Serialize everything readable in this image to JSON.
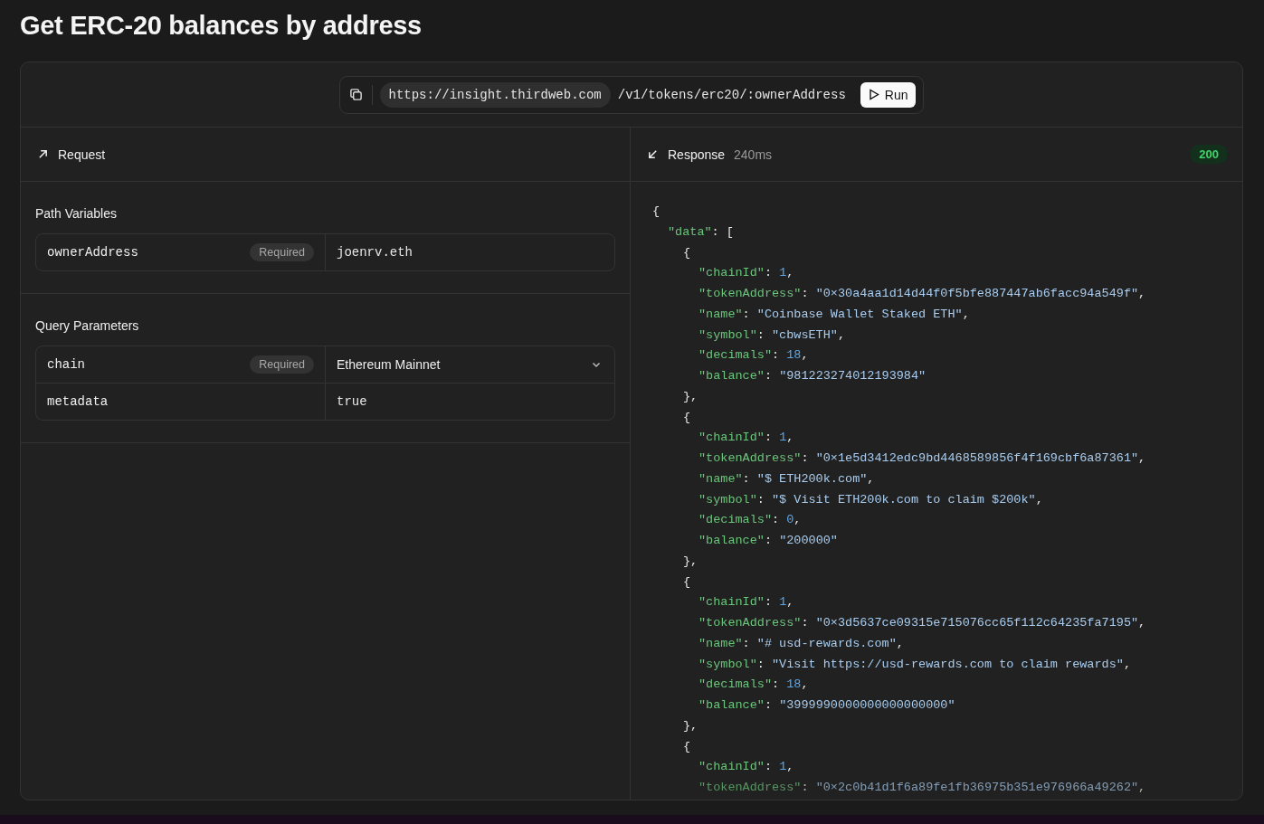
{
  "title": "Get ERC-20 balances by address",
  "url_bar": {
    "base_url": "https://insight.thirdweb.com",
    "path": "/v1/tokens/erc20/:ownerAddress",
    "run_label": "Run"
  },
  "request": {
    "label": "Request",
    "sections": [
      {
        "title": "Path Variables",
        "params": [
          {
            "name": "ownerAddress",
            "required": true,
            "required_label": "Required",
            "kind": "text",
            "value": "joenrv.eth"
          }
        ]
      },
      {
        "title": "Query Parameters",
        "params": [
          {
            "name": "chain",
            "required": true,
            "required_label": "Required",
            "kind": "select",
            "value": "Ethereum Mainnet"
          },
          {
            "name": "metadata",
            "required": false,
            "kind": "text",
            "value": "true"
          }
        ]
      }
    ]
  },
  "response": {
    "label": "Response",
    "time": "240ms",
    "status": "200",
    "lines": [
      {
        "tokens": [
          {
            "kind": "punct",
            "text": "{"
          }
        ],
        "children": [
          {
            "tokens": [
              {
                "kind": "key",
                "text": "\"data\""
              },
              {
                "kind": "punct",
                "text": ": ["
              }
            ],
            "children": [
              {
                "tokens": [
                  {
                    "kind": "punct",
                    "text": "{"
                  }
                ],
                "children": [
                  {
                    "tokens": [
                      {
                        "kind": "key",
                        "text": "\"chainId\""
                      },
                      {
                        "kind": "punct",
                        "text": ": "
                      },
                      {
                        "kind": "number",
                        "text": "1"
                      },
                      {
                        "kind": "punct",
                        "text": ","
                      }
                    ]
                  },
                  {
                    "tokens": [
                      {
                        "kind": "key",
                        "text": "\"tokenAddress\""
                      },
                      {
                        "kind": "punct",
                        "text": ": "
                      },
                      {
                        "kind": "string",
                        "text": "\"0×30a4aa1d14d44f0f5bfe887447ab6facc94a549f\""
                      },
                      {
                        "kind": "punct",
                        "text": ","
                      }
                    ]
                  },
                  {
                    "tokens": [
                      {
                        "kind": "key",
                        "text": "\"name\""
                      },
                      {
                        "kind": "punct",
                        "text": ": "
                      },
                      {
                        "kind": "string",
                        "text": "\"Coinbase Wallet Staked ETH\""
                      },
                      {
                        "kind": "punct",
                        "text": ","
                      }
                    ]
                  },
                  {
                    "tokens": [
                      {
                        "kind": "key",
                        "text": "\"symbol\""
                      },
                      {
                        "kind": "punct",
                        "text": ": "
                      },
                      {
                        "kind": "string",
                        "text": "\"cbwsETH\""
                      },
                      {
                        "kind": "punct",
                        "text": ","
                      }
                    ]
                  },
                  {
                    "tokens": [
                      {
                        "kind": "key",
                        "text": "\"decimals\""
                      },
                      {
                        "kind": "punct",
                        "text": ": "
                      },
                      {
                        "kind": "number",
                        "text": "18"
                      },
                      {
                        "kind": "punct",
                        "text": ","
                      }
                    ]
                  },
                  {
                    "tokens": [
                      {
                        "kind": "key",
                        "text": "\"balance\""
                      },
                      {
                        "kind": "punct",
                        "text": ": "
                      },
                      {
                        "kind": "string",
                        "text": "\"981223274012193984\""
                      }
                    ]
                  }
                ]
              },
              {
                "tokens": [
                  {
                    "kind": "punct",
                    "text": "},"
                  }
                ]
              },
              {
                "tokens": [
                  {
                    "kind": "punct",
                    "text": "{"
                  }
                ],
                "children": [
                  {
                    "tokens": [
                      {
                        "kind": "key",
                        "text": "\"chainId\""
                      },
                      {
                        "kind": "punct",
                        "text": ": "
                      },
                      {
                        "kind": "number",
                        "text": "1"
                      },
                      {
                        "kind": "punct",
                        "text": ","
                      }
                    ]
                  },
                  {
                    "tokens": [
                      {
                        "kind": "key",
                        "text": "\"tokenAddress\""
                      },
                      {
                        "kind": "punct",
                        "text": ": "
                      },
                      {
                        "kind": "string",
                        "text": "\"0×1e5d3412edc9bd4468589856f4f169cbf6a87361\""
                      },
                      {
                        "kind": "punct",
                        "text": ","
                      }
                    ]
                  },
                  {
                    "tokens": [
                      {
                        "kind": "key",
                        "text": "\"name\""
                      },
                      {
                        "kind": "punct",
                        "text": ": "
                      },
                      {
                        "kind": "string",
                        "text": "\"$ ETH200k.com\""
                      },
                      {
                        "kind": "punct",
                        "text": ","
                      }
                    ]
                  },
                  {
                    "tokens": [
                      {
                        "kind": "key",
                        "text": "\"symbol\""
                      },
                      {
                        "kind": "punct",
                        "text": ": "
                      },
                      {
                        "kind": "string",
                        "text": "\"$ Visit ETH200k.com to claim $200k\""
                      },
                      {
                        "kind": "punct",
                        "text": ","
                      }
                    ]
                  },
                  {
                    "tokens": [
                      {
                        "kind": "key",
                        "text": "\"decimals\""
                      },
                      {
                        "kind": "punct",
                        "text": ": "
                      },
                      {
                        "kind": "number",
                        "text": "0"
                      },
                      {
                        "kind": "punct",
                        "text": ","
                      }
                    ]
                  },
                  {
                    "tokens": [
                      {
                        "kind": "key",
                        "text": "\"balance\""
                      },
                      {
                        "kind": "punct",
                        "text": ": "
                      },
                      {
                        "kind": "string",
                        "text": "\"200000\""
                      }
                    ]
                  }
                ]
              },
              {
                "tokens": [
                  {
                    "kind": "punct",
                    "text": "},"
                  }
                ]
              },
              {
                "tokens": [
                  {
                    "kind": "punct",
                    "text": "{"
                  }
                ],
                "children": [
                  {
                    "tokens": [
                      {
                        "kind": "key",
                        "text": "\"chainId\""
                      },
                      {
                        "kind": "punct",
                        "text": ": "
                      },
                      {
                        "kind": "number",
                        "text": "1"
                      },
                      {
                        "kind": "punct",
                        "text": ","
                      }
                    ]
                  },
                  {
                    "tokens": [
                      {
                        "kind": "key",
                        "text": "\"tokenAddress\""
                      },
                      {
                        "kind": "punct",
                        "text": ": "
                      },
                      {
                        "kind": "string",
                        "text": "\"0×3d5637ce09315e715076cc65f112c64235fa7195\""
                      },
                      {
                        "kind": "punct",
                        "text": ","
                      }
                    ]
                  },
                  {
                    "tokens": [
                      {
                        "kind": "key",
                        "text": "\"name\""
                      },
                      {
                        "kind": "punct",
                        "text": ": "
                      },
                      {
                        "kind": "string",
                        "text": "\"# usd-rewards.com\""
                      },
                      {
                        "kind": "punct",
                        "text": ","
                      }
                    ]
                  },
                  {
                    "tokens": [
                      {
                        "kind": "key",
                        "text": "\"symbol\""
                      },
                      {
                        "kind": "punct",
                        "text": ": "
                      },
                      {
                        "kind": "string",
                        "text": "\"Visit https://usd-rewards.com to claim rewards\""
                      },
                      {
                        "kind": "punct",
                        "text": ","
                      }
                    ]
                  },
                  {
                    "tokens": [
                      {
                        "kind": "key",
                        "text": "\"decimals\""
                      },
                      {
                        "kind": "punct",
                        "text": ": "
                      },
                      {
                        "kind": "number",
                        "text": "18"
                      },
                      {
                        "kind": "punct",
                        "text": ","
                      }
                    ]
                  },
                  {
                    "tokens": [
                      {
                        "kind": "key",
                        "text": "\"balance\""
                      },
                      {
                        "kind": "punct",
                        "text": ": "
                      },
                      {
                        "kind": "string",
                        "text": "\"3999990000000000000000\""
                      }
                    ]
                  }
                ]
              },
              {
                "tokens": [
                  {
                    "kind": "punct",
                    "text": "},"
                  }
                ]
              },
              {
                "tokens": [
                  {
                    "kind": "punct",
                    "text": "{"
                  }
                ],
                "children": [
                  {
                    "tokens": [
                      {
                        "kind": "key",
                        "text": "\"chainId\""
                      },
                      {
                        "kind": "punct",
                        "text": ": "
                      },
                      {
                        "kind": "number",
                        "text": "1"
                      },
                      {
                        "kind": "punct",
                        "text": ","
                      }
                    ]
                  },
                  {
                    "tokens": [
                      {
                        "kind": "key",
                        "text": "\"tokenAddress\""
                      },
                      {
                        "kind": "punct",
                        "text": ": "
                      },
                      {
                        "kind": "string",
                        "text": "\"0×2c0b41d1f6a89fe1fb36975b351e976966a49262\""
                      },
                      {
                        "kind": "punct",
                        "text": ","
                      }
                    ]
                  }
                ]
              }
            ]
          }
        ]
      }
    ]
  }
}
